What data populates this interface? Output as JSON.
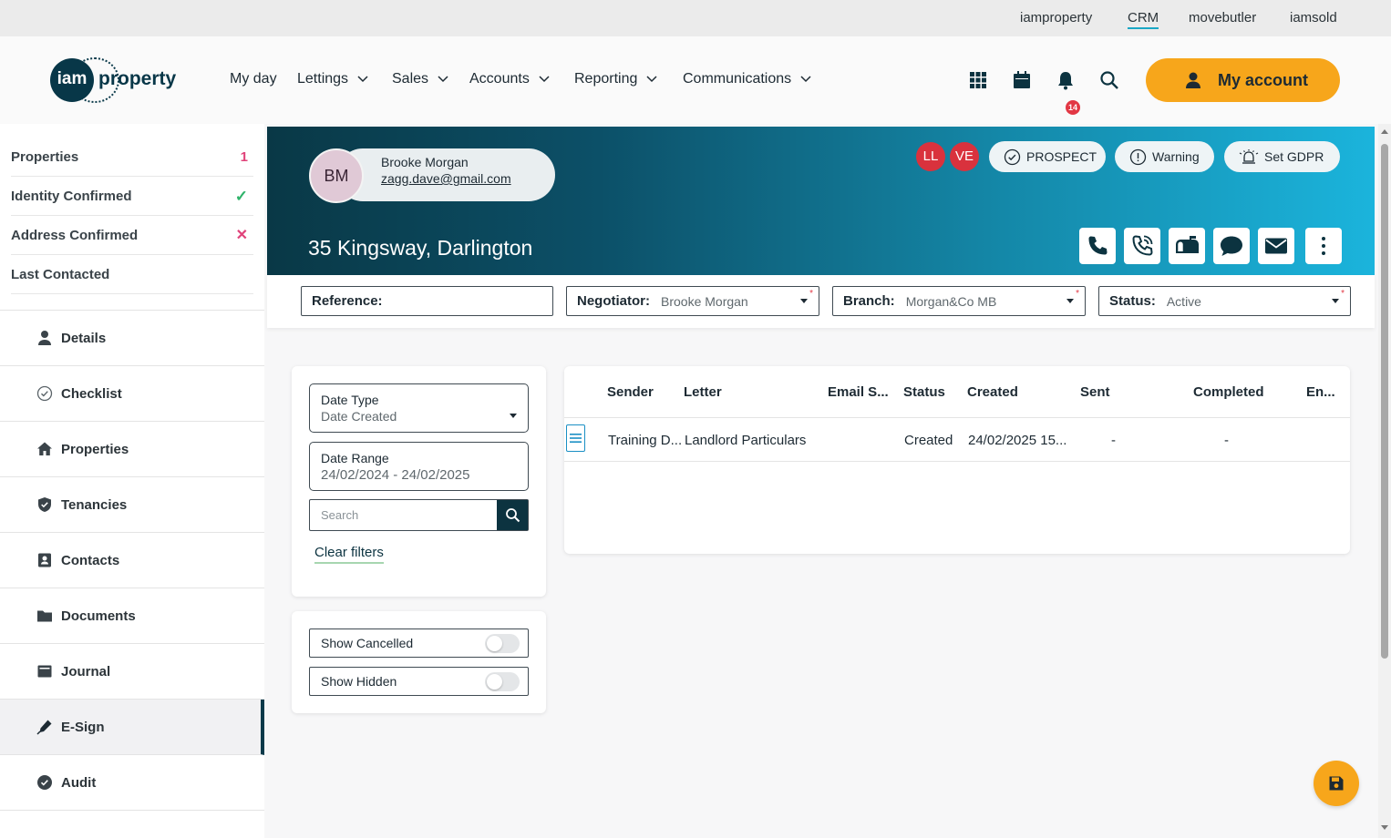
{
  "top_links": [
    "iamproperty",
    "CRM",
    "movebutler",
    "iamsold"
  ],
  "logo": {
    "mark": "iam",
    "word": "property"
  },
  "nav": {
    "my_day": "My day",
    "lettings": "Lettings",
    "sales": "Sales",
    "accounts": "Accounts",
    "reporting": "Reporting",
    "communications": "Communications"
  },
  "header_icons": [
    "apps-grid-icon",
    "calendar-icon",
    "bell-icon",
    "search-icon"
  ],
  "notification_count": "14",
  "my_account": "My account",
  "sidebar": {
    "stats": [
      {
        "label": "Properties",
        "value": "1"
      },
      {
        "label": "Identity Confirmed",
        "value": "✓"
      },
      {
        "label": "Address Confirmed",
        "value": "✕"
      },
      {
        "label": "Last Contacted",
        "value": ""
      }
    ],
    "items": [
      {
        "label": "Details",
        "icon": "person-icon"
      },
      {
        "label": "Checklist",
        "icon": "check-circle-icon"
      },
      {
        "label": "Properties",
        "icon": "home-icon"
      },
      {
        "label": "Tenancies",
        "icon": "shield-icon"
      },
      {
        "label": "Contacts",
        "icon": "contact-card-icon"
      },
      {
        "label": "Documents",
        "icon": "folder-icon"
      },
      {
        "label": "Journal",
        "icon": "journal-icon"
      },
      {
        "label": "E-Sign",
        "icon": "pen-icon"
      },
      {
        "label": "Audit",
        "icon": "check-badge-icon"
      }
    ],
    "active_item": "E-Sign"
  },
  "hero": {
    "initials": "BM",
    "name": "Brooke Morgan",
    "email": "zagg.dave@gmail.com",
    "address": "35 Kingsway, Darlington",
    "user_badges": [
      "LL",
      "VE"
    ],
    "prospect": "PROSPECT",
    "warning": "Warning",
    "gdpr": "Set GDPR",
    "actions": [
      "phone-icon",
      "phone-call-icon",
      "mailbox-icon",
      "chat-icon",
      "envelope-icon",
      "more-vertical-icon"
    ]
  },
  "filters": {
    "reference_label": "Reference:",
    "reference_value": "",
    "negotiator_label": "Negotiator:",
    "negotiator_value": "Brooke Morgan",
    "branch_label": "Branch:",
    "branch_value": "Morgan&Co MB",
    "status_label": "Status:",
    "status_value": "Active"
  },
  "left_filters": {
    "date_type_label": "Date Type",
    "date_type_value": "Date Created",
    "date_range_label": "Date Range",
    "date_range_value": "24/02/2024 - 24/02/2025",
    "search_placeholder": "Search",
    "clear_filters": "Clear filters",
    "show_cancelled": "Show Cancelled",
    "show_hidden": "Show Hidden",
    "show_cancelled_on": false,
    "show_hidden_on": false
  },
  "table": {
    "columns": [
      "Sender",
      "Letter",
      "Email S...",
      "Status",
      "Created",
      "Sent",
      "Completed",
      "En..."
    ],
    "rows": [
      {
        "sender": "Training D...",
        "letter": "Landlord Particulars",
        "email_subject": "",
        "status": "Created",
        "created": "24/02/2025 15...",
        "sent": "-",
        "completed": "-",
        "end": ""
      }
    ]
  },
  "colors": {
    "accent": "#f7a61b",
    "primary_dark": "#0c3340",
    "hero_start": "#093846",
    "hero_end": "#1bb4dc",
    "danger": "#e23744",
    "success": "#2fb36a",
    "pink": "#e0437a"
  }
}
